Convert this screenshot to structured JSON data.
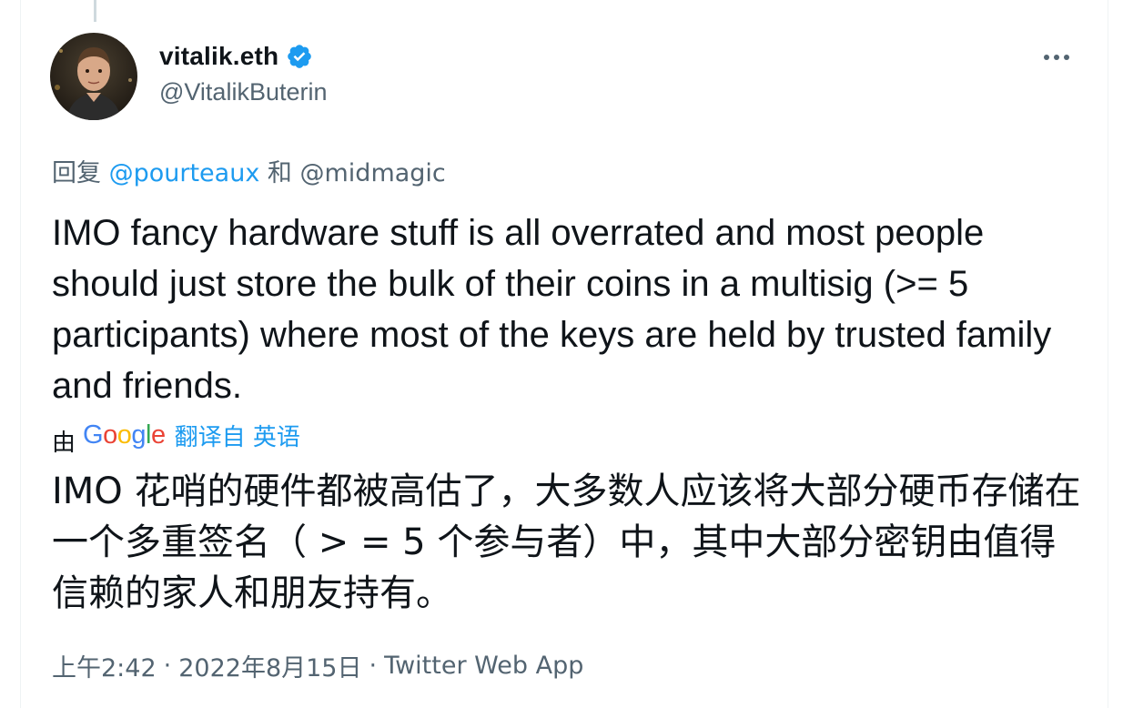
{
  "author": {
    "display_name": "vitalik.eth",
    "handle": "@VitalikButerin",
    "verified_icon": "verified-badge-icon"
  },
  "reply": {
    "prefix": "回复",
    "mention_1": "@pourteaux",
    "conjunction": "和",
    "mention_2": "@midmagic"
  },
  "tweet": {
    "text": "IMO fancy hardware stuff is all overrated and most people should just store the bulk of their coins in a multisig (>= 5 participants) where most of the keys are held by trusted family and friends."
  },
  "translation": {
    "by_label": "由",
    "provider_g1": "G",
    "provider_o1": "o",
    "provider_o2": "o",
    "provider_g2": "g",
    "provider_l": "l",
    "provider_e": "e",
    "translated_from": "翻译自 英语",
    "text": "IMO 花哨的硬件都被高估了，大多数人应该将大部分硬币存储在一个多重签名（ > = 5 个参与者）中，其中大部分密钥由值得信赖的家人和朋友持有。"
  },
  "meta": {
    "time": "上午2:42",
    "separator_1": "·",
    "date": "2022年8月15日",
    "separator_2": "·",
    "source": "Twitter Web App"
  },
  "colors": {
    "accent": "#1d9bf0",
    "secondary_text": "#536471",
    "primary_text": "#0f1419",
    "google_blue": "#4285F4",
    "google_red": "#EA4335",
    "google_yellow": "#FBBC05",
    "google_green": "#34A853"
  }
}
